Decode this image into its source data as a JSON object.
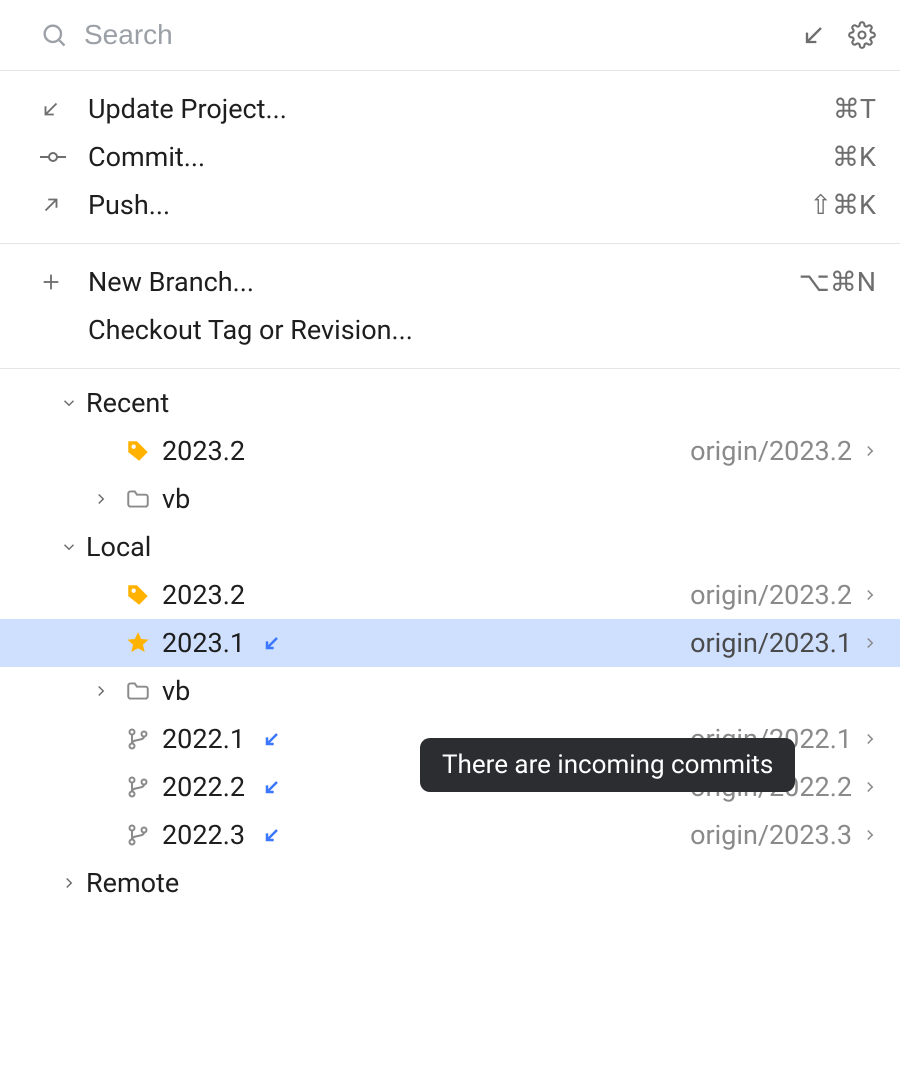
{
  "header": {
    "search_placeholder": "Search"
  },
  "actions": {
    "update": {
      "label": "Update Project...",
      "shortcut": "⌘T"
    },
    "commit": {
      "label": "Commit...",
      "shortcut": "⌘K"
    },
    "push": {
      "label": "Push...",
      "shortcut": "⇧⌘K"
    },
    "new_branch": {
      "label": "New Branch...",
      "shortcut": "⌥⌘N"
    },
    "checkout_tag": {
      "label": "Checkout Tag or Revision..."
    }
  },
  "groups": {
    "recent": {
      "label": "Recent",
      "items": [
        {
          "icon": "tag",
          "label": "2023.2",
          "remote": "origin/2023.2",
          "has_chevron": true
        },
        {
          "icon": "folder",
          "label": "vb",
          "expandable": true
        }
      ]
    },
    "local": {
      "label": "Local",
      "items": [
        {
          "icon": "tag",
          "label": "2023.2",
          "remote": "origin/2023.2",
          "has_chevron": true
        },
        {
          "icon": "star",
          "label": "2023.1",
          "remote": "origin/2023.1",
          "has_chevron": true,
          "incoming": true,
          "selected": true
        },
        {
          "icon": "folder",
          "label": "vb",
          "expandable": true
        },
        {
          "icon": "branch",
          "label": "2022.1",
          "remote": "origin/2022.1",
          "has_chevron": true,
          "incoming": true
        },
        {
          "icon": "branch",
          "label": "2022.2",
          "remote": "origin/2022.2",
          "has_chevron": true,
          "incoming": true
        },
        {
          "icon": "branch",
          "label": "2022.3",
          "remote": "origin/2023.3",
          "has_chevron": true,
          "incoming": true
        }
      ]
    },
    "remote": {
      "label": "Remote"
    }
  },
  "tooltip": {
    "text": "There are incoming commits"
  }
}
